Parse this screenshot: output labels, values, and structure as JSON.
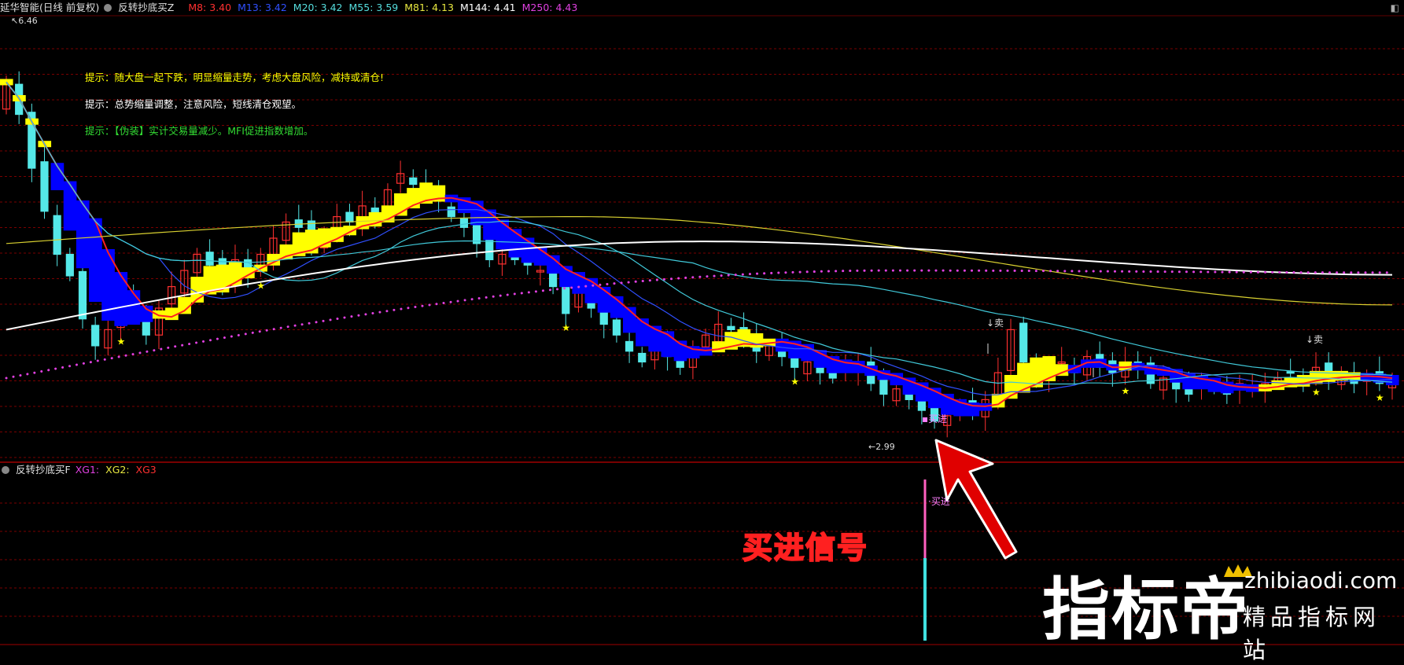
{
  "top_panel": {
    "title": "延华智能(日线 前复权)",
    "indicator": "反转抄底买Z",
    "ma_items": [
      {
        "text": "M8: 3.40",
        "color": "#ff3030"
      },
      {
        "text": "M13: 3.42",
        "color": "#3050ff"
      },
      {
        "text": "M20: 3.42",
        "color": "#55dddd"
      },
      {
        "text": "M55: 3.59",
        "color": "#55dddd"
      },
      {
        "text": "M81: 4.13",
        "color": "#e8e840"
      },
      {
        "text": "M144: 4.41",
        "color": "#ffffff"
      },
      {
        "text": "M250: 4.43",
        "color": "#e040e0"
      }
    ]
  },
  "tips": [
    {
      "text": "提示：随大盘一起下跌，明显缩量走势，考虑大盘风险，减持或清仓!",
      "color": "#ffff00"
    },
    {
      "text": "提示：总势缩量调整，注意风险，短线清仓观望。",
      "color": "#ffffff"
    },
    {
      "text": "提示：【伪装】实计交易量减少。MFI促进指数增加。",
      "color": "#33dd33"
    }
  ],
  "bottom_panel": {
    "indicator": "反转抄底买F",
    "items": [
      {
        "text": "XG1:",
        "color": "#e040e0"
      },
      {
        "text": "XG2:",
        "color": "#e8e840"
      },
      {
        "text": "XG3",
        "color": "#ff3030"
      }
    ]
  },
  "annotations": {
    "high_label": "6.46",
    "low_label": "2.99",
    "buy_label": "买进",
    "sell_label": "卖",
    "signal_title": "买进信号"
  },
  "watermark": {
    "name": "指标帝",
    "url": "zhibiaodi.com",
    "slogan": "精品指标网站"
  },
  "chart_data": {
    "type": "candlestick",
    "title": "延华智能(日线 前复权)",
    "y_high": 6.46,
    "y_low": 2.99,
    "ylim": [
      2.8,
      6.7
    ],
    "ma_last_values": {
      "M8": 3.4,
      "M13": 3.42,
      "M20": 3.42,
      "M55": 3.59,
      "M81": 4.13,
      "M144": 4.41,
      "M250": 4.43
    },
    "colors": {
      "up": "#ff3030",
      "down": "#55e8e8",
      "bull_band": "#ffff00",
      "bear_band": "#0000ff",
      "ma8": "#ff2020",
      "ma13": "#3050ff",
      "ma20": "#40c8d8",
      "ma81": "#d8d030",
      "ma144": "#ffffff",
      "ma250": "#e040e0"
    },
    "candles_close": [
      6.2,
      5.9,
      5.4,
      5.0,
      4.6,
      4.4,
      4.0,
      3.75,
      3.9,
      4.2,
      4.05,
      3.85,
      4.1,
      4.3,
      4.45,
      4.6,
      4.5,
      4.35,
      4.55,
      4.4,
      4.6,
      4.75,
      4.9,
      4.85,
      4.7,
      4.8,
      4.95,
      4.9,
      5.05,
      4.95,
      5.2,
      5.35,
      5.25,
      5.15,
      5.1,
      4.95,
      4.85,
      4.7,
      4.55,
      4.6,
      4.55,
      4.5,
      4.45,
      4.3,
      4.05,
      4.25,
      4.1,
      3.95,
      3.85,
      3.7,
      3.6,
      3.75,
      3.65,
      3.55,
      3.7,
      3.85,
      3.95,
      3.9,
      3.8,
      3.7,
      3.75,
      3.65,
      3.55,
      3.6,
      3.5,
      3.45,
      3.55,
      3.6,
      3.4,
      3.3,
      3.35,
      3.25,
      3.15,
      3.05,
      3.1,
      3.2,
      3.15,
      3.25,
      3.5,
      3.9,
      3.6,
      3.45,
      3.55,
      3.6,
      3.5,
      3.65,
      3.55,
      3.5,
      3.6,
      3.55,
      3.4,
      3.45,
      3.35,
      3.3,
      3.4,
      3.35,
      3.3,
      3.4,
      3.35,
      3.4,
      3.45,
      3.5,
      3.45,
      3.55,
      3.45,
      3.5,
      3.4,
      3.45,
      3.4,
      3.4
    ],
    "current": {
      "close": 3.4
    }
  }
}
